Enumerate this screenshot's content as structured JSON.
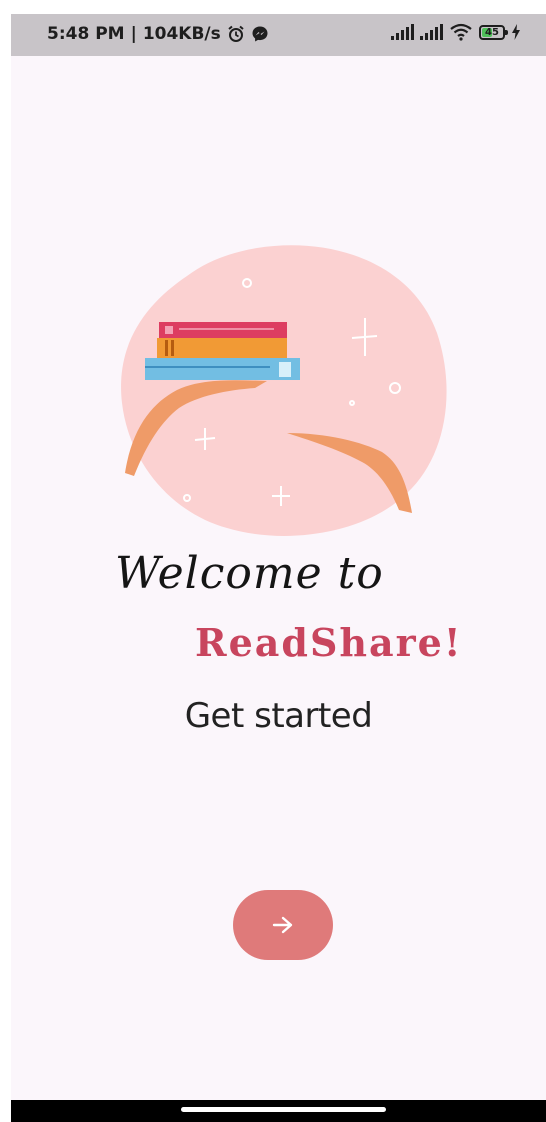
{
  "status_bar": {
    "time": "5:48 PM",
    "separator": "|",
    "speed": "104KB/s",
    "icons": [
      "alarm-icon",
      "messenger-icon",
      "signal-icon",
      "signal-icon",
      "wifi-icon",
      "battery-icon",
      "charging-icon"
    ],
    "battery_level": "45"
  },
  "welcome": {
    "greeting": "Welcome to",
    "app_name": "ReadShare!",
    "subtitle": "Get started"
  },
  "next_button": {
    "icon": "arrow-right-icon"
  },
  "colors": {
    "brand": "#c8455e",
    "button": "#df7a7a",
    "background": "#fbf6fb",
    "blob": "#fbd1d1"
  }
}
